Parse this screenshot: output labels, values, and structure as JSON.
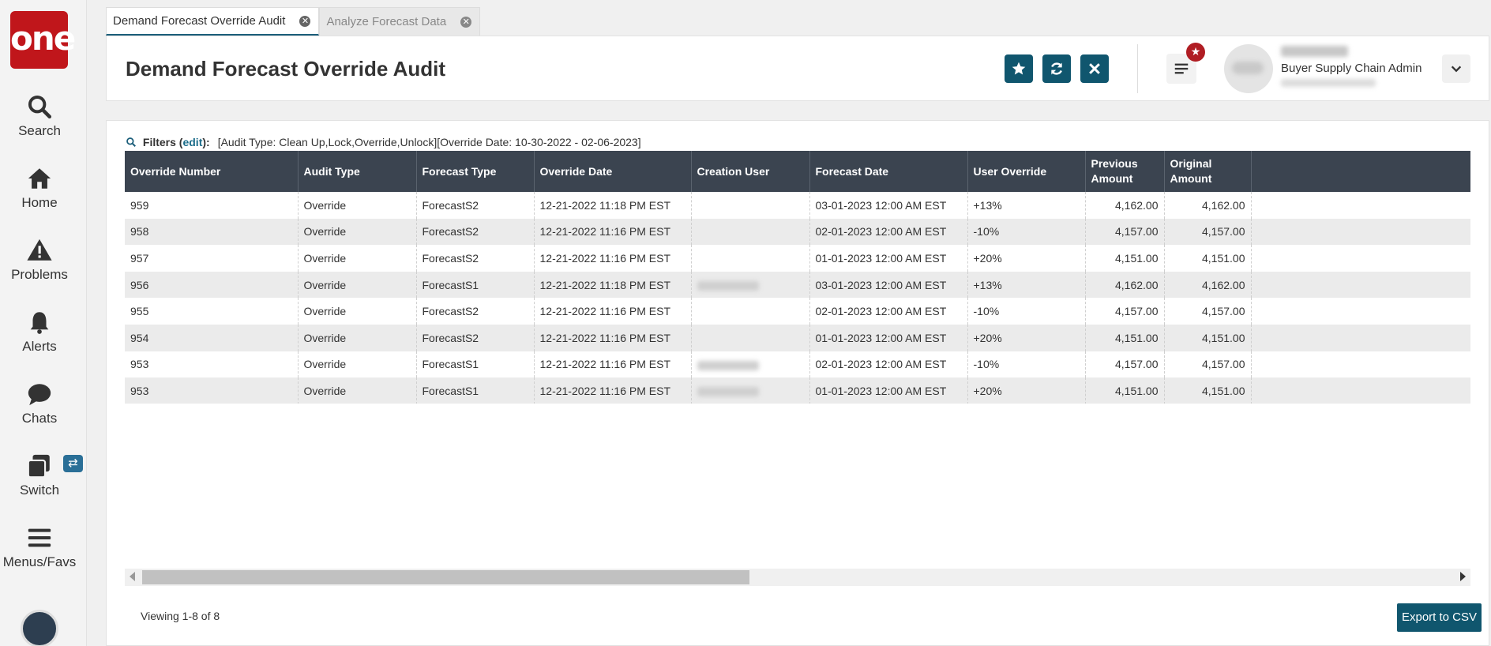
{
  "logo": "one",
  "nav": [
    {
      "label": "Search",
      "icon": "search-icon"
    },
    {
      "label": "Home",
      "icon": "home-icon"
    },
    {
      "label": "Problems",
      "icon": "warning-icon"
    },
    {
      "label": "Alerts",
      "icon": "bell-icon"
    },
    {
      "label": "Chats",
      "icon": "chat-icon"
    },
    {
      "label": "Switch",
      "icon": "switch-icon"
    },
    {
      "label": "Menus/Favs",
      "icon": "menu-icon"
    }
  ],
  "tabs": [
    {
      "label": "Demand Forecast Override Audit",
      "active": true
    },
    {
      "label": "Analyze Forecast Data",
      "active": false
    }
  ],
  "header": {
    "title": "Demand Forecast Override Audit",
    "user_role": "Buyer Supply Chain Admin"
  },
  "filters": {
    "label": "Filters (",
    "edit": "edit",
    "suffix": "):",
    "value": "[Audit Type: Clean Up,Lock,Override,Unlock][Override Date: 10-30-2022 - 02-06-2023]"
  },
  "table": {
    "columns": [
      "Override Number",
      "Audit Type",
      "Forecast Type",
      "Override Date",
      "Creation User",
      "Forecast Date",
      "User Override",
      "Previous Amount",
      "Original Amount"
    ],
    "rows": [
      {
        "num": "959",
        "audit": "Override",
        "ftype": "ForecastS2",
        "odate": "12-21-2022 11:18 PM EST",
        "user_blurred": false,
        "fdate": "03-01-2023 12:00 AM EST",
        "uover": "+13%",
        "prev": "4,162.00",
        "orig": "4,162.00"
      },
      {
        "num": "958",
        "audit": "Override",
        "ftype": "ForecastS2",
        "odate": "12-21-2022 11:16 PM EST",
        "user_blurred": false,
        "fdate": "02-01-2023 12:00 AM EST",
        "uover": "-10%",
        "prev": "4,157.00",
        "orig": "4,157.00"
      },
      {
        "num": "957",
        "audit": "Override",
        "ftype": "ForecastS2",
        "odate": "12-21-2022 11:16 PM EST",
        "user_blurred": false,
        "fdate": "01-01-2023 12:00 AM EST",
        "uover": "+20%",
        "prev": "4,151.00",
        "orig": "4,151.00"
      },
      {
        "num": "956",
        "audit": "Override",
        "ftype": "ForecastS1",
        "odate": "12-21-2022 11:18 PM EST",
        "user_blurred": true,
        "fdate": "03-01-2023 12:00 AM EST",
        "uover": "+13%",
        "prev": "4,162.00",
        "orig": "4,162.00"
      },
      {
        "num": "955",
        "audit": "Override",
        "ftype": "ForecastS2",
        "odate": "12-21-2022 11:16 PM EST",
        "user_blurred": false,
        "fdate": "02-01-2023 12:00 AM EST",
        "uover": "-10%",
        "prev": "4,157.00",
        "orig": "4,157.00"
      },
      {
        "num": "954",
        "audit": "Override",
        "ftype": "ForecastS2",
        "odate": "12-21-2022 11:16 PM EST",
        "user_blurred": false,
        "fdate": "01-01-2023 12:00 AM EST",
        "uover": "+20%",
        "prev": "4,151.00",
        "orig": "4,151.00"
      },
      {
        "num": "953",
        "audit": "Override",
        "ftype": "ForecastS1",
        "odate": "12-21-2022 11:16 PM EST",
        "user_blurred": true,
        "fdate": "02-01-2023 12:00 AM EST",
        "uover": "-10%",
        "prev": "4,157.00",
        "orig": "4,157.00"
      },
      {
        "num": "953",
        "audit": "Override",
        "ftype": "ForecastS1",
        "odate": "12-21-2022 11:16 PM EST",
        "user_blurred": true,
        "fdate": "01-01-2023 12:00 AM EST",
        "uover": "+20%",
        "prev": "4,151.00",
        "orig": "4,151.00"
      }
    ]
  },
  "footer": {
    "viewing": "Viewing 1-8 of 8",
    "export": "Export to CSV"
  },
  "colors": {
    "brand": "#c0161b",
    "primary": "#10566e",
    "header_bg": "#3b4450",
    "badge": "#b01d23"
  }
}
